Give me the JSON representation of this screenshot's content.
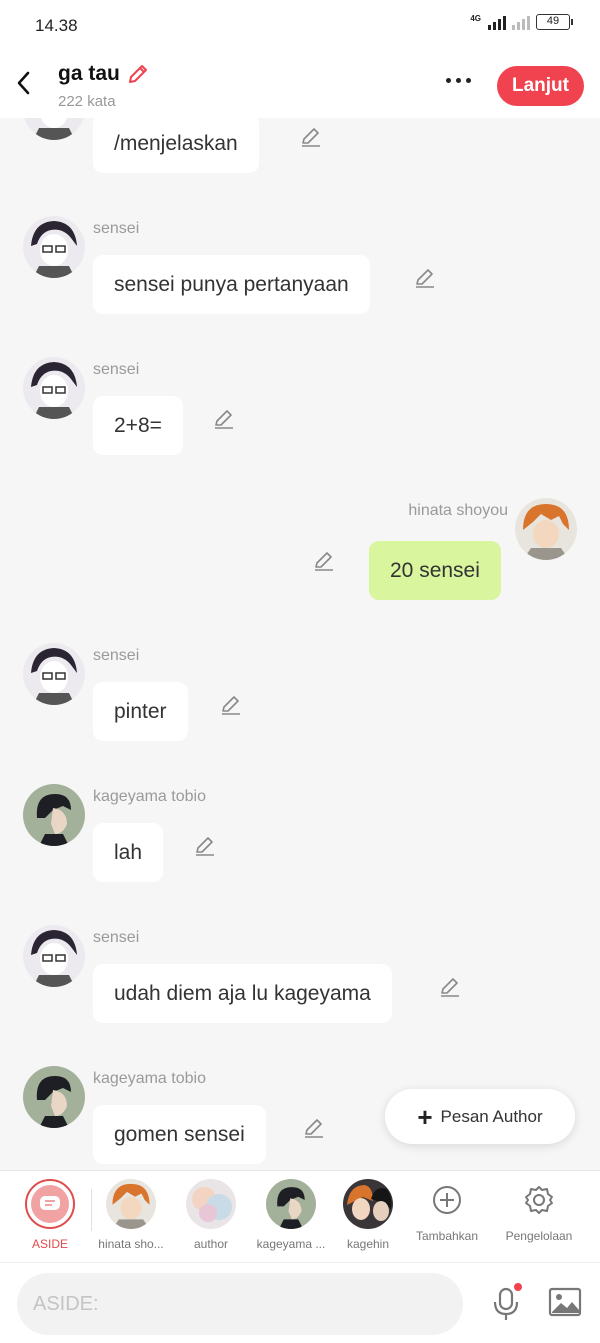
{
  "status_bar": {
    "time": "14.38",
    "network": "4G",
    "battery": "49"
  },
  "header": {
    "title": "ga tau",
    "subtitle": "222 kata",
    "next_label": "Lanjut"
  },
  "messages": [
    {
      "sender": "",
      "text": "/menjelaskan",
      "side": "left",
      "avatar": "sensei"
    },
    {
      "sender": "sensei",
      "text": "sensei punya pertanyaan",
      "side": "left",
      "avatar": "sensei"
    },
    {
      "sender": "sensei",
      "text": "2+8=",
      "side": "left",
      "avatar": "sensei"
    },
    {
      "sender": "hinata shoyou",
      "text": "20 sensei",
      "side": "right",
      "avatar": "hinata"
    },
    {
      "sender": "sensei",
      "text": "pinter",
      "side": "left",
      "avatar": "sensei"
    },
    {
      "sender": "kageyama tobio",
      "text": "lah",
      "side": "left",
      "avatar": "kageyama"
    },
    {
      "sender": "sensei",
      "text": "udah diem aja lu kageyama",
      "side": "left",
      "avatar": "sensei"
    },
    {
      "sender": "kageyama tobio",
      "text": "gomen sensei",
      "side": "left",
      "avatar": "kageyama"
    }
  ],
  "fab": {
    "label": "Pesan Author"
  },
  "characters": [
    {
      "label": "ASIDE"
    },
    {
      "label": "hinata sho..."
    },
    {
      "label": "author"
    },
    {
      "label": "kageyama ..."
    },
    {
      "label": "kagehin"
    },
    {
      "label": "Tambahkan"
    },
    {
      "label": "Pengelolaan"
    }
  ],
  "input": {
    "placeholder": "ASIDE:"
  },
  "colors": {
    "accent": "#f0434f",
    "my_bubble": "#d9f59d",
    "background": "#f6f6f6"
  }
}
